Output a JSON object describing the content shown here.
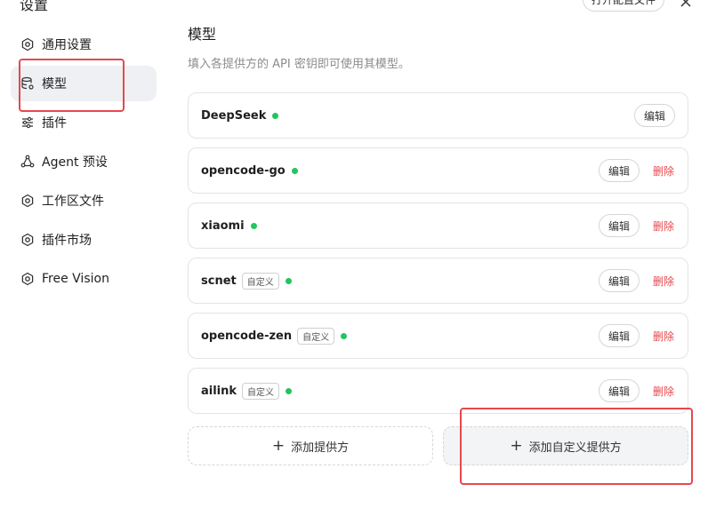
{
  "header": {
    "title": "设置",
    "open_config_label": "打开配置文件"
  },
  "sidebar": {
    "items": [
      {
        "label": "通用设置",
        "icon": "gear-icon",
        "active": false
      },
      {
        "label": "模型",
        "icon": "database-icon",
        "active": true
      },
      {
        "label": "插件",
        "icon": "sliders-icon",
        "active": false
      },
      {
        "label": "Agent 预设",
        "icon": "agent-icon",
        "active": false
      },
      {
        "label": "工作区文件",
        "icon": "gear-icon",
        "active": false
      },
      {
        "label": "插件市场",
        "icon": "gear-icon",
        "active": false
      },
      {
        "label": "Free Vision",
        "icon": "gear-icon",
        "active": false
      }
    ]
  },
  "main": {
    "title": "模型",
    "subtitle": "填入各提供方的 API 密钥即可使用其模型。",
    "edit_label": "编辑",
    "delete_label": "删除",
    "custom_tag": "自定义",
    "status_color": "#22c55e",
    "providers": [
      {
        "name": "DeepSeek",
        "custom": false,
        "deletable": false
      },
      {
        "name": "opencode-go",
        "custom": false,
        "deletable": true
      },
      {
        "name": "xiaomi",
        "custom": false,
        "deletable": true
      },
      {
        "name": "scnet",
        "custom": true,
        "deletable": true
      },
      {
        "name": "opencode-zen",
        "custom": true,
        "deletable": true
      },
      {
        "name": "ailink",
        "custom": true,
        "deletable": true
      }
    ],
    "add_provider_label": "添加提供方",
    "add_custom_provider_label": "添加自定义提供方"
  }
}
